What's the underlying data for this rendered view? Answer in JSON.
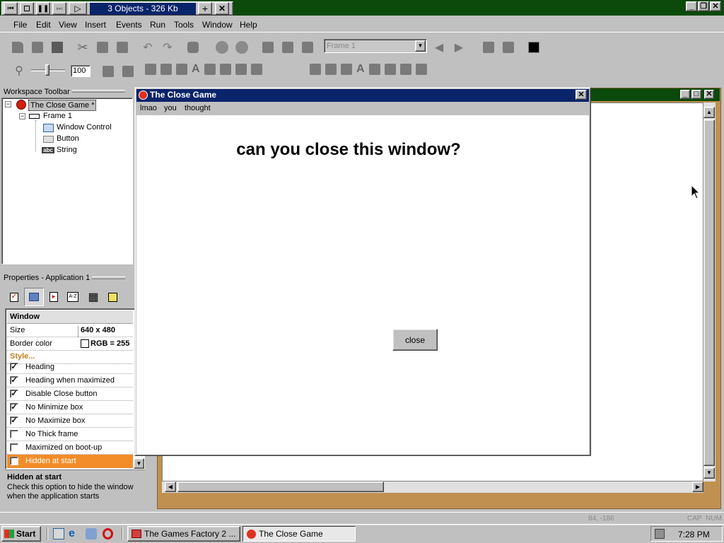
{
  "topbar": {
    "title": "3 Objects - 326 Kb"
  },
  "menubar": {
    "items": [
      {
        "label": "File",
        "name": "file"
      },
      {
        "label": "Edit",
        "name": "edit"
      },
      {
        "label": "View",
        "name": "view"
      },
      {
        "label": "Insert",
        "name": "insert"
      },
      {
        "label": "Events",
        "name": "events"
      },
      {
        "label": "Run",
        "name": "run"
      },
      {
        "label": "Tools",
        "name": "tools"
      },
      {
        "label": "Window",
        "name": "window"
      },
      {
        "label": "Help",
        "name": "help"
      }
    ]
  },
  "toolbar": {
    "frame_select": "Frame 1",
    "zoom_value": "100"
  },
  "workspace": {
    "title": "Workspace Toolbar",
    "tree": {
      "app": "The Close Game *",
      "frame": "Frame 1",
      "objects": [
        "Window Control",
        "Button",
        "String"
      ]
    }
  },
  "properties": {
    "title": "Properties - Application 1",
    "section": "Window",
    "size_label": "Size",
    "size_value": "640 x 480",
    "border_label": "Border color",
    "border_value": "RGB = 255",
    "style_label": "Style...",
    "options": [
      {
        "label": "Heading",
        "checked": true
      },
      {
        "label": "Heading when maximized",
        "checked": true
      },
      {
        "label": "Disable Close button",
        "checked": true
      },
      {
        "label": "No Minimize box",
        "checked": true
      },
      {
        "label": "No Maximize box",
        "checked": true
      },
      {
        "label": "No Thick frame",
        "checked": false
      },
      {
        "label": "Maximized on boot-up",
        "checked": false
      },
      {
        "label": "Hidden at start",
        "checked": false
      }
    ],
    "help_title": "Hidden at start",
    "help_text": "Check this option to hide the window when the application starts"
  },
  "game_window": {
    "title": "The Close Game",
    "menu": [
      "lmao",
      "you",
      "thought"
    ],
    "question": "can you close this window?",
    "close_label": "close"
  },
  "statusbar": {
    "coords": "84, -186",
    "caps": "CAP",
    "num": "NUM"
  },
  "taskbar": {
    "start": "Start",
    "tasks": [
      "The Games Factory 2 ...",
      "The Close Game"
    ],
    "clock": "7:28 PM"
  },
  "colors": {
    "titlebar_active": "#0a246a",
    "desktop_green": "#0b4a0b",
    "selected_row": "#f28c28",
    "style_label": "#c08020"
  }
}
